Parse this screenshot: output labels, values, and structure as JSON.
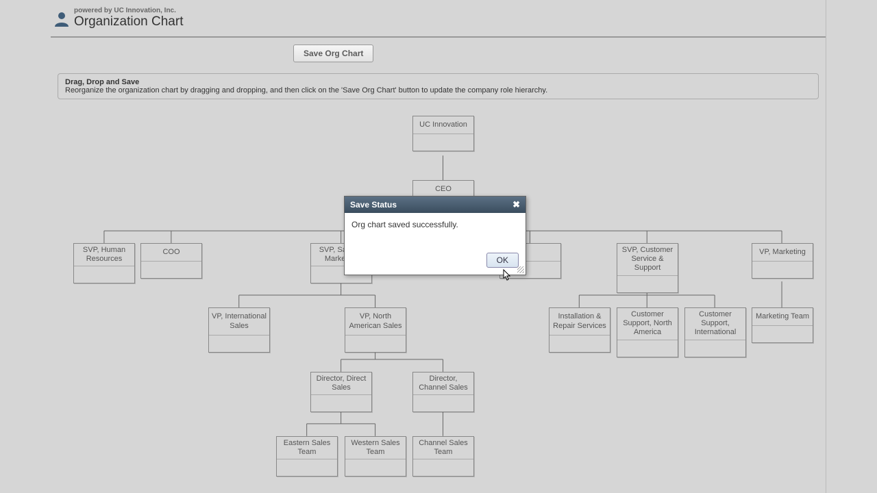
{
  "header": {
    "powered": "powered by UC Innovation, Inc.",
    "title": "Organization Chart"
  },
  "toolbar": {
    "save_label": "Save Org Chart"
  },
  "hint": {
    "title": "Drag, Drop and Save",
    "body": "Reorganize the organization chart by dragging and dropping, and then click on the 'Save Org Chart' button to update the company role hierarchy."
  },
  "nodes": {
    "root": "UC Innovation",
    "ceo": "CEO",
    "hr": "SVP, Human Resources",
    "coo": "COO",
    "sales_mkt": "SVP, Sales & Marketing",
    "partial": "",
    "cust_svc": "SVP, Customer Service & Support",
    "vp_mkt": "VP, Marketing",
    "vp_intl": "VP, International Sales",
    "vp_na": "VP, North American Sales",
    "install": "Installation & Repair Services",
    "cs_na": "Customer Support, North America",
    "cs_intl": "Customer Support, International",
    "mkt_team": "Marketing Team",
    "dir_direct": "Director, Direct Sales",
    "dir_channel": "Director, Channel Sales",
    "east": "Eastern Sales Team",
    "west": "Western Sales Team",
    "channel_team": "Channel Sales Team"
  },
  "dialog": {
    "title": "Save Status",
    "message": "Org chart saved successfully.",
    "ok": "OK"
  }
}
